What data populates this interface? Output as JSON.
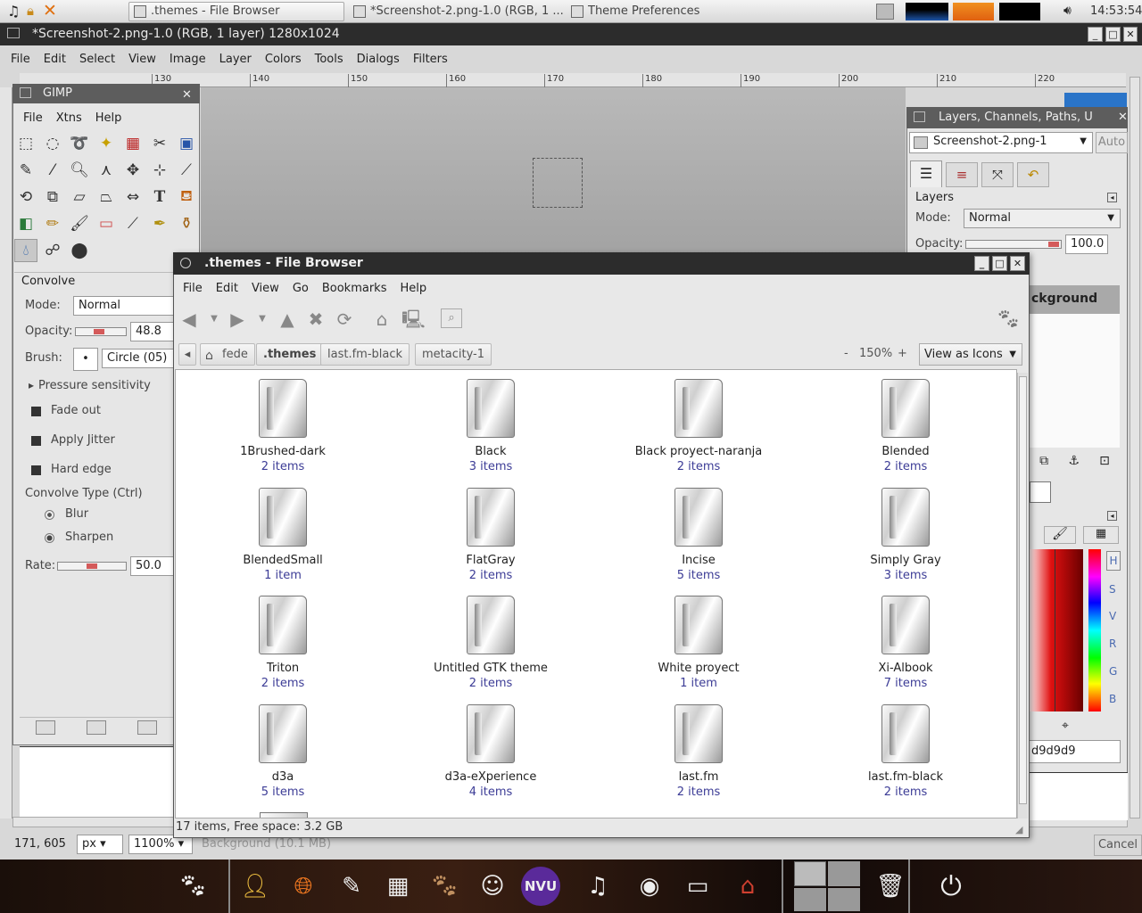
{
  "top_panel": {
    "tasks": [
      {
        "label": ".themes - File Browser"
      },
      {
        "label": "*Screenshot-2.png-1.0 (RGB, 1 ..."
      },
      {
        "label": "Theme Preferences"
      }
    ],
    "clock": "14:53:54"
  },
  "gimp_image": {
    "title": "*Screenshot-2.png-1.0 (RGB, 1 layer) 1280x1024",
    "menu": [
      "File",
      "Edit",
      "Select",
      "View",
      "Image",
      "Layer",
      "Colors",
      "Tools",
      "Dialogs",
      "Filters"
    ],
    "ruler_ticks": [
      "130",
      "140",
      "150",
      "160",
      "170",
      "180",
      "190",
      "200",
      "210",
      "220"
    ],
    "status": {
      "coords": "171, 605",
      "unit": "px",
      "zoom": "1100%",
      "layer_info": "Background (10.1 MB)",
      "cancel": "Cancel"
    }
  },
  "toolbox": {
    "title": "GIMP",
    "menu": [
      "File",
      "Xtns",
      "Help"
    ],
    "tool_name": "Convolve",
    "mode_label": "Mode:",
    "mode_value": "Normal",
    "opacity_label": "Opacity:",
    "opacity_value": "48.8",
    "brush_label": "Brush:",
    "brush_value": "Circle (05)",
    "pressure": "Pressure sensitivity",
    "fade_out": "Fade out",
    "apply_jitter": "Apply Jitter",
    "hard_edge": "Hard edge",
    "convolve_type": "Convolve Type  (Ctrl)",
    "blur": "Blur",
    "sharpen": "Sharpen",
    "rate_label": "Rate:",
    "rate_value": "50.0"
  },
  "layers_dock": {
    "title": "Layers, Channels, Paths, U",
    "image_select": "Screenshot-2.png-1",
    "auto": "Auto",
    "section": "Layers",
    "mode_label": "Mode:",
    "mode_value": "Normal",
    "opacity_label": "Opacity:",
    "opacity_value": "100.0",
    "layer_name": "ckground",
    "hex_value": "d9d9d9",
    "color_tabs": [
      "H",
      "S",
      "V",
      "R",
      "G",
      "B"
    ]
  },
  "file_browser": {
    "title": ".themes - File Browser",
    "menu": [
      "File",
      "Edit",
      "View",
      "Go",
      "Bookmarks",
      "Help"
    ],
    "breadcrumbs": [
      "fede",
      ".themes",
      "last.fm-black",
      "metacity-1"
    ],
    "zoom_minus": "-",
    "zoom": "150%",
    "zoom_plus": "+",
    "view_mode": "View as Icons",
    "folders": [
      {
        "name": "1Brushed-dark",
        "count": "2 items"
      },
      {
        "name": "Black",
        "count": "3 items"
      },
      {
        "name": "Black proyect-naranja",
        "count": "2 items"
      },
      {
        "name": "Blended",
        "count": "2 items"
      },
      {
        "name": "BlendedSmall",
        "count": "1 item"
      },
      {
        "name": "FlatGray",
        "count": "2 items"
      },
      {
        "name": "Incise",
        "count": "5 items"
      },
      {
        "name": "Simply Gray",
        "count": "3 items"
      },
      {
        "name": "Triton",
        "count": "2 items"
      },
      {
        "name": "Untitled GTK theme",
        "count": "2 items"
      },
      {
        "name": "White proyect",
        "count": "1 item"
      },
      {
        "name": "Xi-Albook",
        "count": "7 items"
      },
      {
        "name": "d3a",
        "count": "5 items"
      },
      {
        "name": "d3a-eXperience",
        "count": "4 items"
      },
      {
        "name": "last.fm",
        "count": "2 items"
      },
      {
        "name": "last.fm-black",
        "count": "2 items"
      }
    ],
    "status": "17 items, Free space: 3.2 GB"
  },
  "dock_apps": [
    "foot-icon",
    "user-icon",
    "firefox-icon",
    "text-editor-icon",
    "calculator-icon",
    "gimp-icon",
    "chat-icon",
    "nvu-icon",
    "music-icon",
    "speaker-icon",
    "terminal-icon",
    "home-icon",
    "workspace-icon",
    "trash-icon",
    "power-icon"
  ]
}
